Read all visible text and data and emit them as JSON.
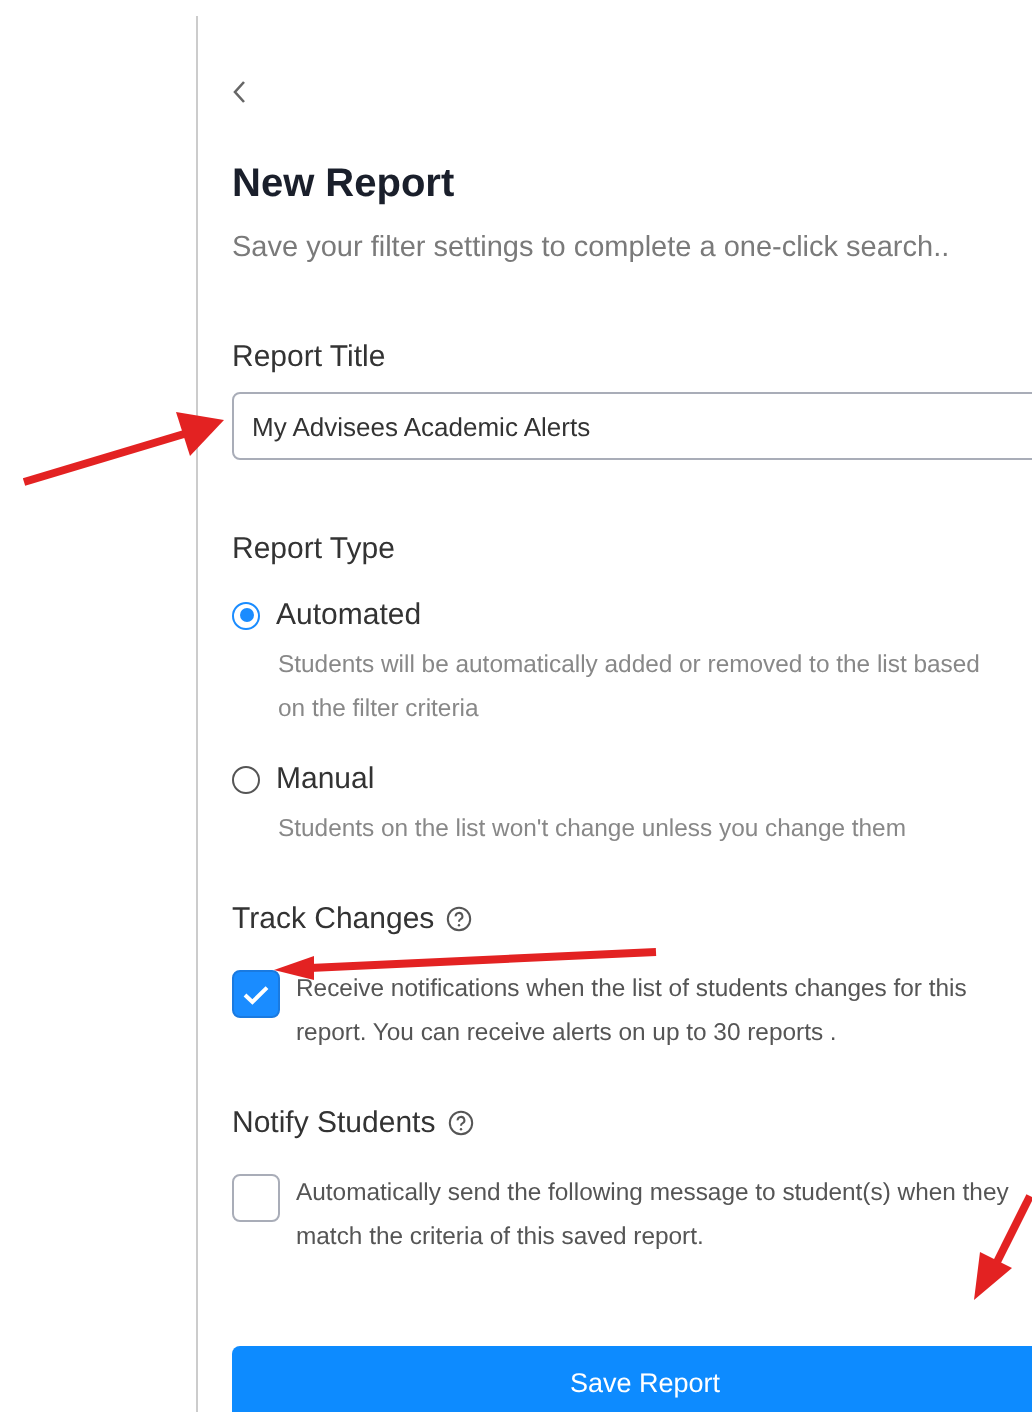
{
  "title": "New Report",
  "subtitle": "Save your filter settings to complete a one-click search..",
  "report_title": {
    "label": "Report Title",
    "value": "My Advisees Academic Alerts"
  },
  "report_type": {
    "label": "Report Type",
    "options": [
      {
        "label": "Automated",
        "description": "Students will be automatically added or removed to the list based on the filter criteria",
        "selected": true
      },
      {
        "label": "Manual",
        "description": "Students on the list won't change unless you change them",
        "selected": false
      }
    ]
  },
  "options": [
    {
      "label": "Track Changes",
      "checked": true,
      "description": "Receive notifications when the list of students changes for this report. You can receive alerts on up to 30 reports ."
    },
    {
      "label": "Notify Students",
      "checked": false,
      "description": "Automatically send the following message to student(s) when they match the criteria of this saved report."
    }
  ],
  "save_button": "Save Report"
}
